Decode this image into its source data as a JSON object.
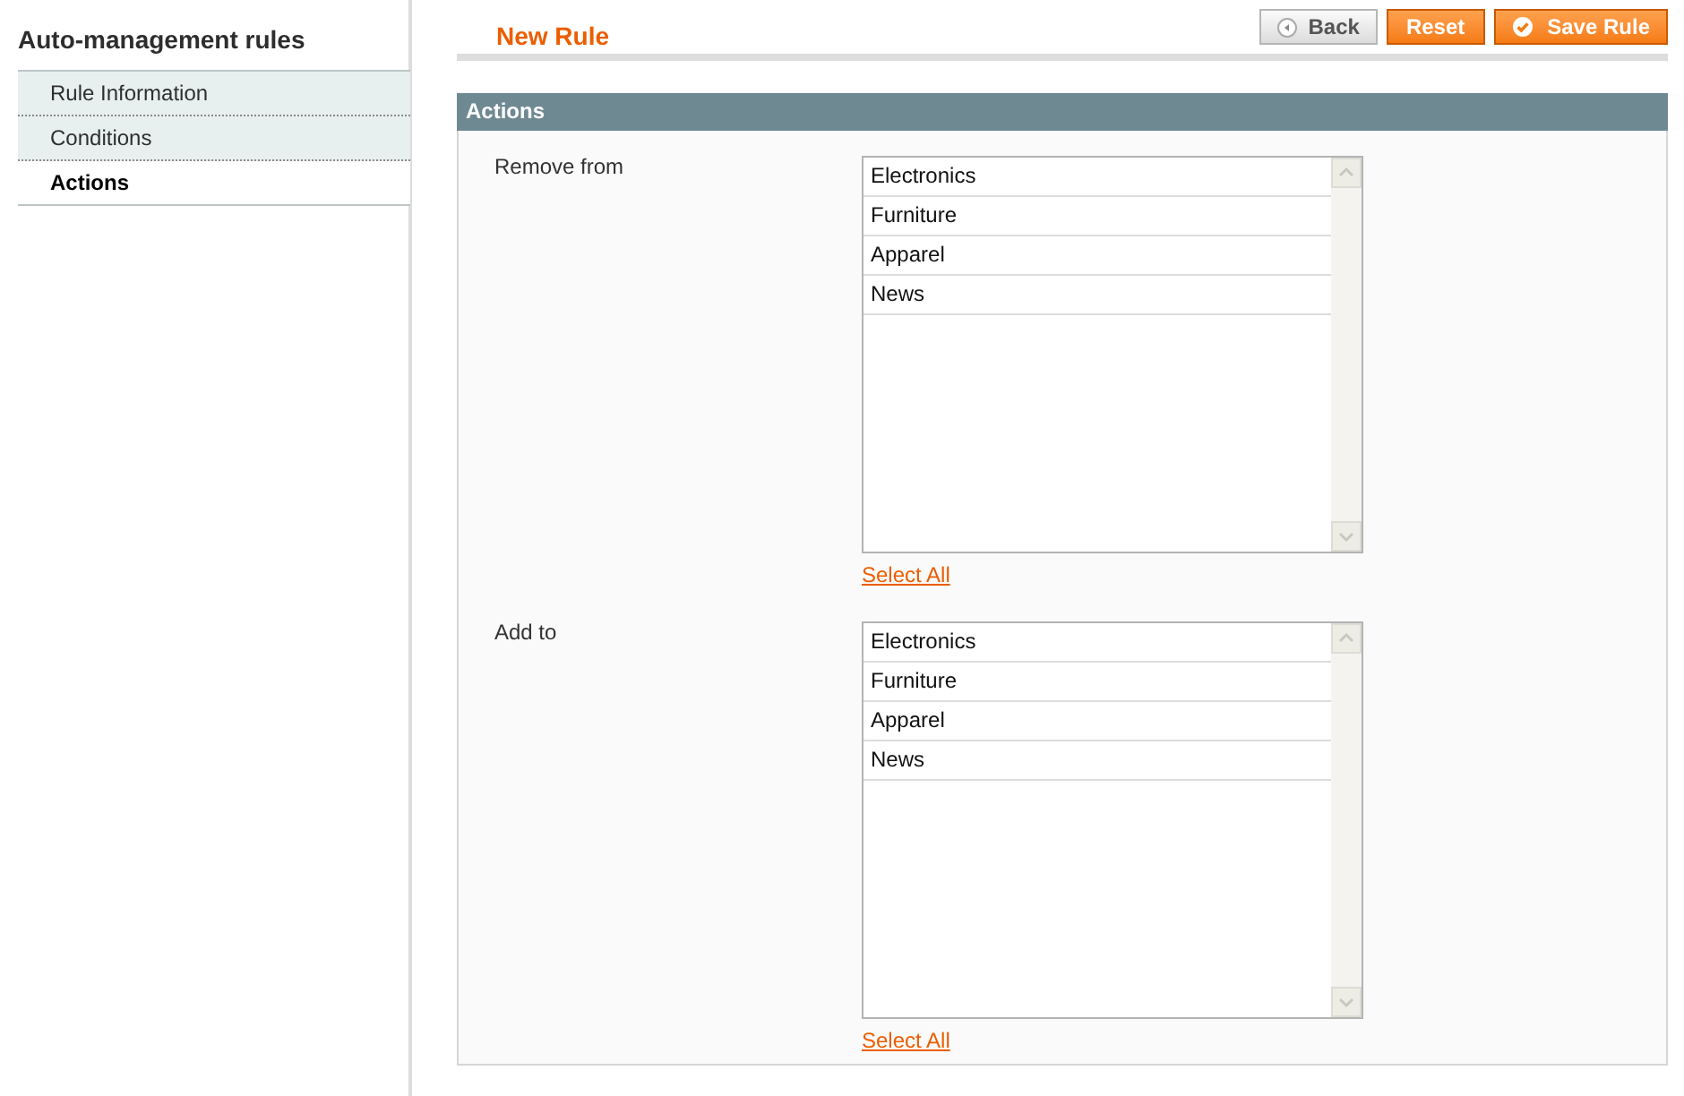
{
  "sidebar": {
    "title": "Auto-management rules",
    "tabs": [
      {
        "label": "Rule Information",
        "selected": false
      },
      {
        "label": "Conditions",
        "selected": false
      },
      {
        "label": "Actions",
        "selected": true
      }
    ]
  },
  "header": {
    "title": "New Rule",
    "buttons": [
      {
        "label": "Back",
        "kind": "back"
      },
      {
        "label": "Reset",
        "kind": "reset"
      },
      {
        "label": "Save Rule",
        "kind": "save"
      }
    ]
  },
  "section": {
    "title": "Actions",
    "fields": [
      {
        "label": "Remove from",
        "options": [
          "Electronics",
          "Furniture",
          "Apparel",
          "News"
        ],
        "link": "Select All"
      },
      {
        "label": "Add to",
        "options": [
          "Electronics",
          "Furniture",
          "Apparel",
          "News"
        ],
        "link": "Select All"
      }
    ]
  }
}
